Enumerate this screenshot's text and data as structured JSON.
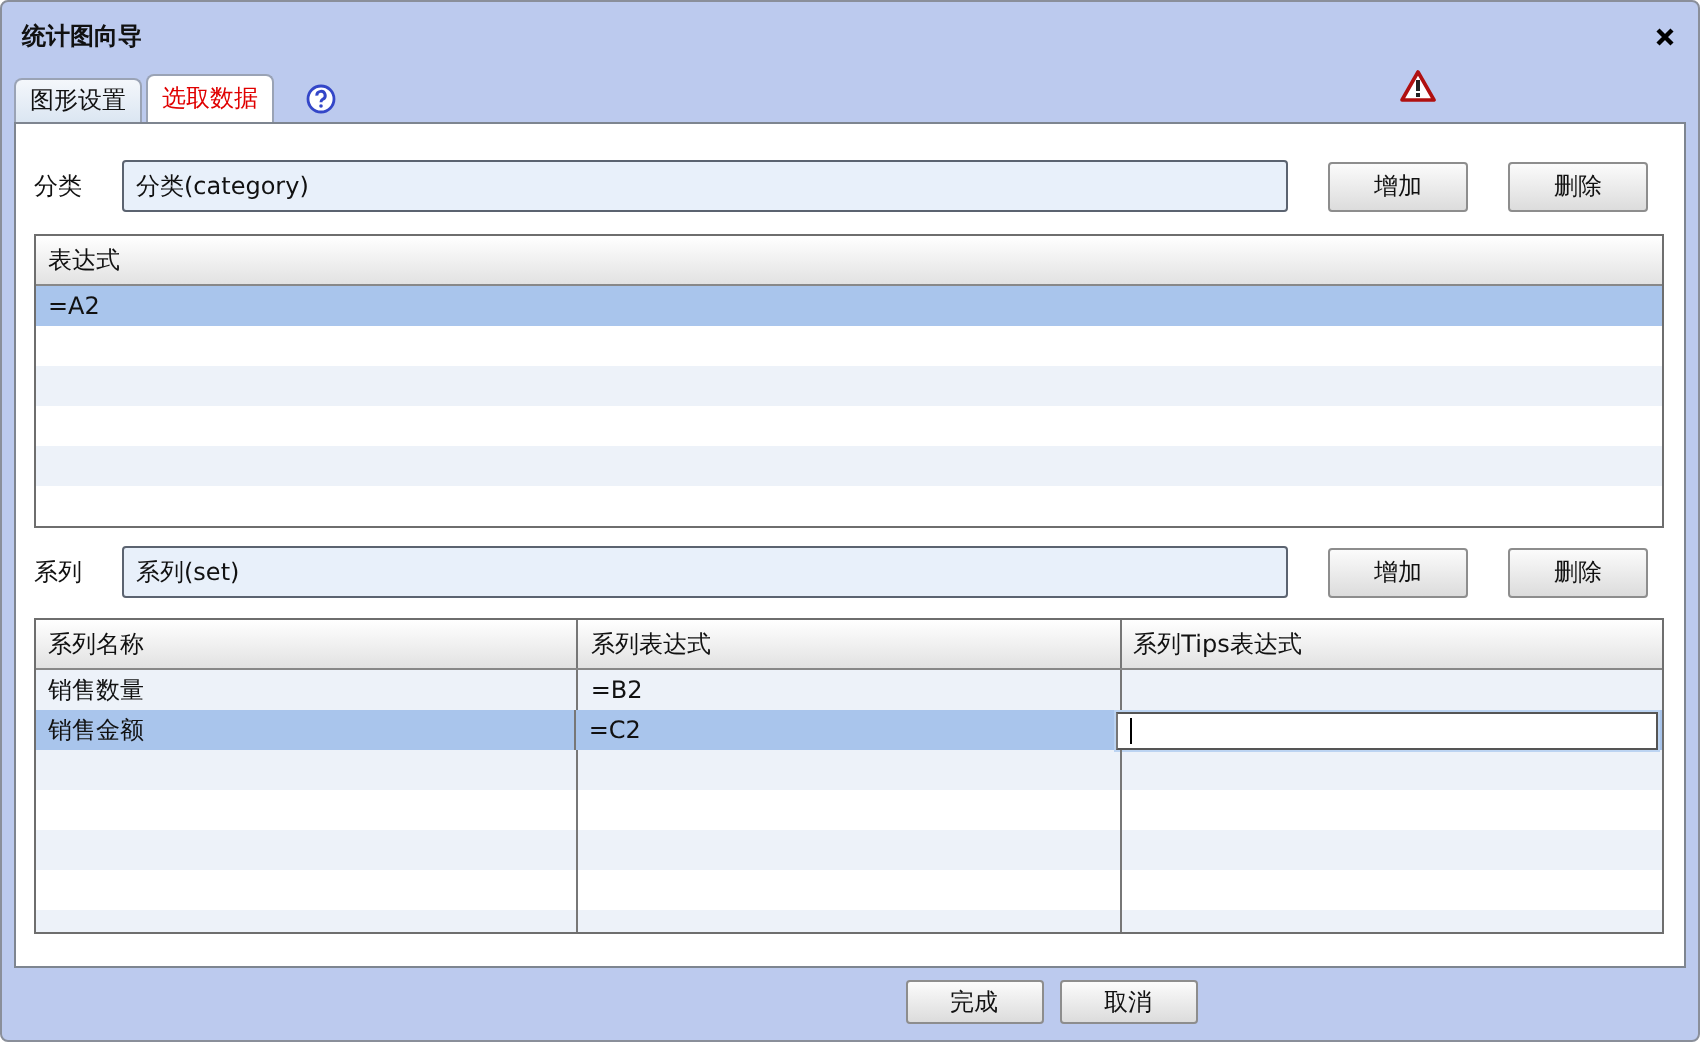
{
  "window": {
    "title": "统计图向导"
  },
  "tabs": [
    {
      "label": "图形设置",
      "selected": false
    },
    {
      "label": "选取数据",
      "selected": true
    }
  ],
  "category": {
    "label": "分类",
    "value": "分类(category)",
    "buttons": [
      "增加",
      "删除"
    ],
    "table": {
      "columns": [
        "表达式"
      ],
      "rows": [
        {
          "cells": [
            "=A2"
          ],
          "selected": true
        }
      ]
    }
  },
  "series": {
    "label": "系列",
    "value": "系列(set)",
    "buttons": [
      "增加",
      "删除"
    ],
    "table": {
      "columns": [
        "系列名称",
        "系列表达式",
        "系列Tips表达式"
      ],
      "rows": [
        {
          "cells": [
            "销售数量",
            "=B2",
            ""
          ],
          "selected": false,
          "editing": false
        },
        {
          "cells": [
            "销售金额",
            "=C2",
            ""
          ],
          "selected": true,
          "editing": true
        }
      ]
    }
  },
  "footer_buttons": [
    "完成",
    "取消"
  ]
}
